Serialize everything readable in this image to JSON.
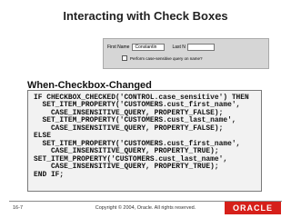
{
  "slide": {
    "title": "Interacting with Check Boxes",
    "section_heading": "When-Checkbox-Changed"
  },
  "form": {
    "first_name_label": "First Name",
    "first_name_value": "Constantin",
    "last_name_label": "Last N",
    "checkbox_label": "Perform case-sensitive query on name?",
    "checkbox_checked": false
  },
  "code": {
    "text": "IF CHECKBOX_CHECKED('CONTROL.case_sensitive') THEN\n  SET_ITEM_PROPERTY('CUSTOMERS.cust_first_name',\n    CASE_INSENSITIVE_QUERY, PROPERTY_FALSE);\n  SET_ITEM_PROPERTY('CUSTOMERS.cust_last_name',\n    CASE_INSENSITIVE_QUERY, PROPERTY_FALSE);\nELSE\n  SET_ITEM_PROPERTY('CUSTOMERS.cust_first_name',\n    CASE_INSENSITIVE_QUERY, PROPERTY_TRUE);\nSET_ITEM_PROPERTY('CUSTOMERS.cust_last_name',\n    CASE_INSENSITIVE_QUERY, PROPERTY_TRUE);\nEND IF;"
  },
  "footer": {
    "page_number": "16-7",
    "copyright": "Copyright © 2004, Oracle.  All rights reserved.",
    "logo_text": "ORACLE",
    "logo_color": "#d6201a"
  }
}
